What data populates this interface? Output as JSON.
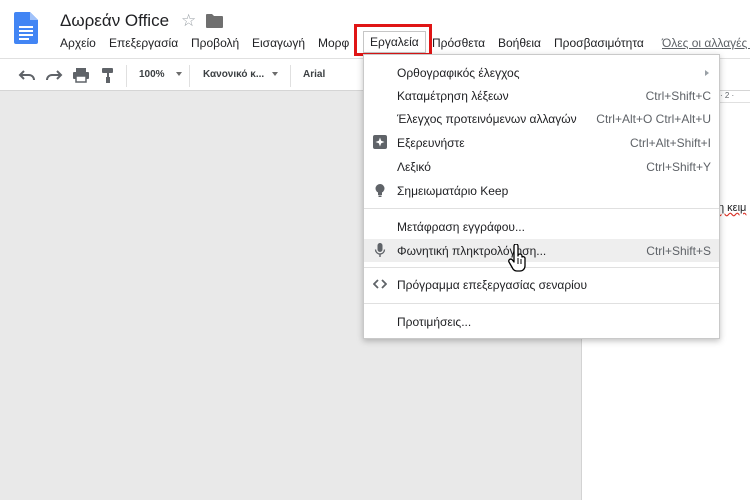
{
  "app": {
    "doc_title": "Δωρεάν Office",
    "all_changes_link": "Όλες οι αλλαγές ο"
  },
  "menubar": {
    "items": [
      "Αρχείο",
      "Επεξεργασία",
      "Προβολή",
      "Εισαγωγή",
      "Μορφ"
    ],
    "tools": "Εργαλεία",
    "after": [
      "Πρόσθετα",
      "Βοήθεια",
      "Προσβασιμότητα"
    ]
  },
  "toolbar": {
    "zoom": "100%",
    "style": "Κανονικό κ...",
    "font": "Arial"
  },
  "ruler": {
    "label": "· 2 ·"
  },
  "page": {
    "fragment": "η κειμ"
  },
  "tools_menu": {
    "items": [
      {
        "label": "Ορθογραφικός έλεγχος",
        "shortcut": ""
      },
      {
        "label": "Καταμέτρηση λέξεων",
        "shortcut": "Ctrl+Shift+C"
      },
      {
        "label": "Έλεγχος προτεινόμενων αλλαγών",
        "shortcut": "Ctrl+Alt+O Ctrl+Alt+U"
      },
      {
        "label": "Εξερευνήστε",
        "shortcut": "Ctrl+Alt+Shift+I"
      },
      {
        "label": "Λεξικό",
        "shortcut": "Ctrl+Shift+Y"
      },
      {
        "label": "Σημειωματάριο Keep",
        "shortcut": ""
      },
      {
        "label": "Μετάφραση εγγράφου...",
        "shortcut": ""
      },
      {
        "label": "Φωνητική πληκτρολόγηση...",
        "shortcut": "Ctrl+Shift+S"
      },
      {
        "label": "Πρόγραμμα επεξεργασίας σεναρίου",
        "shortcut": ""
      },
      {
        "label": "Προτιμήσεις...",
        "shortcut": ""
      }
    ]
  },
  "colors": {
    "highlight_box": "#e01515",
    "doc_icon_blue": "#4285f4",
    "canvas_gray": "#e9e9e9",
    "menu_hover": "#eeeeee"
  }
}
